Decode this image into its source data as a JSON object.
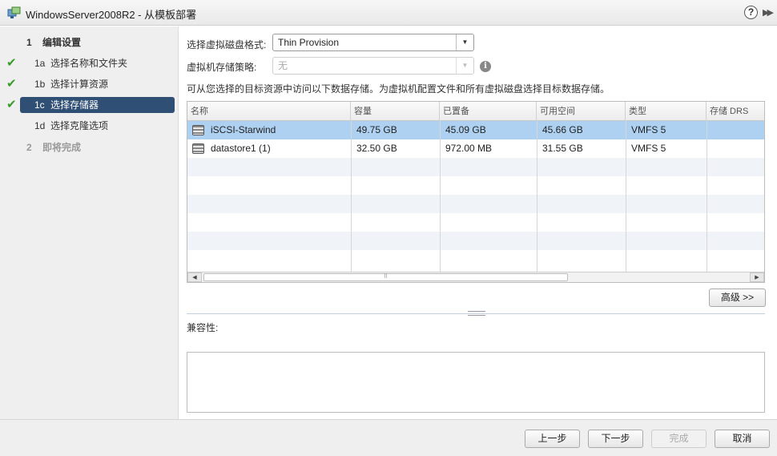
{
  "window": {
    "title": "WindowsServer2008R2 - 从模板部署",
    "help": "?",
    "expand": "▶▶"
  },
  "sidebar": {
    "section1": {
      "num": "1",
      "label": "编辑设置"
    },
    "items": [
      {
        "num": "1a",
        "label": "选择名称和文件夹",
        "done": true
      },
      {
        "num": "1b",
        "label": "选择计算资源",
        "done": true
      },
      {
        "num": "1c",
        "label": "选择存储器",
        "done": true,
        "selected": true
      },
      {
        "num": "1d",
        "label": "选择克隆选项",
        "done": false
      }
    ],
    "section2": {
      "num": "2",
      "label": "即将完成"
    },
    "check_glyph": "✔"
  },
  "form": {
    "disk_format_label": "选择虚拟磁盘格式:",
    "disk_format_value": "Thin Provision",
    "policy_label": "虚拟机存储策略:",
    "policy_value": "无",
    "info_glyph": "i",
    "description": "可从您选择的目标资源中访问以下数据存储。为虚拟机配置文件和所有虚拟磁盘选择目标数据存储。"
  },
  "grid": {
    "columns": [
      "名称",
      "容量",
      "已置备",
      "可用空间",
      "类型",
      "存储 DRS"
    ],
    "rows": [
      {
        "name": "iSCSI-Starwind",
        "capacity": "49.75 GB",
        "provisioned": "45.09 GB",
        "free": "45.66 GB",
        "type": "VMFS 5",
        "drs": "",
        "selected": true
      },
      {
        "name": "datastore1 (1)",
        "capacity": "32.50 GB",
        "provisioned": "972.00 MB",
        "free": "31.55 GB",
        "type": "VMFS 5",
        "drs": "",
        "selected": false
      }
    ],
    "scroll_left": "◀",
    "scroll_right": "▶",
    "scroll_grip": "⠿"
  },
  "advanced_button": "高级 >>",
  "compatibility_label": "兼容性:",
  "footer": {
    "back": "上一步",
    "next": "下一步",
    "finish": "完成",
    "cancel": "取消"
  }
}
